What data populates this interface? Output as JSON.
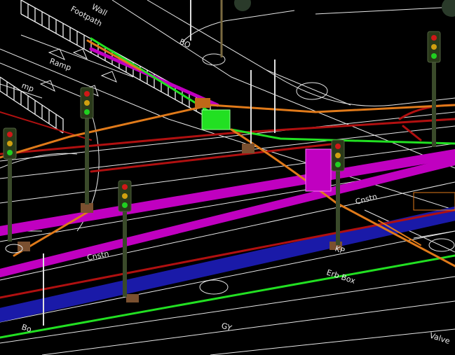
{
  "labels": {
    "footpath": "Footpath",
    "wall": "Wall",
    "ramp": "Ramp",
    "bo": "BO",
    "bo_small": "Bo",
    "cnstn_left": "Cnstn",
    "cnstn_right": "Cnstn",
    "erb_box": "Erb Box",
    "gy": "GY",
    "valve": "Valve",
    "kp": "KP",
    "ramp_left": "mp"
  },
  "colors": {
    "background": "#000000",
    "road_lines": "#ffffff",
    "ducts_magenta": "#c000c0",
    "duct_blue": "#1a1aa8",
    "pipe_orange": "#e07a1a",
    "cable_red": "#b01010",
    "cable_green": "#22e022",
    "signal_pole": "#3a4a2a",
    "signal_head": "#2a3a1a"
  },
  "signals": [
    {
      "lights": [
        "red",
        "amber",
        "green"
      ]
    },
    {
      "lights": [
        "red",
        "amber",
        "green"
      ]
    },
    {
      "lights": [
        "red",
        "amber",
        "green"
      ]
    },
    {
      "lights": [
        "red",
        "amber",
        "green"
      ]
    },
    {
      "lights": [
        "red",
        "amber",
        "green"
      ]
    }
  ]
}
